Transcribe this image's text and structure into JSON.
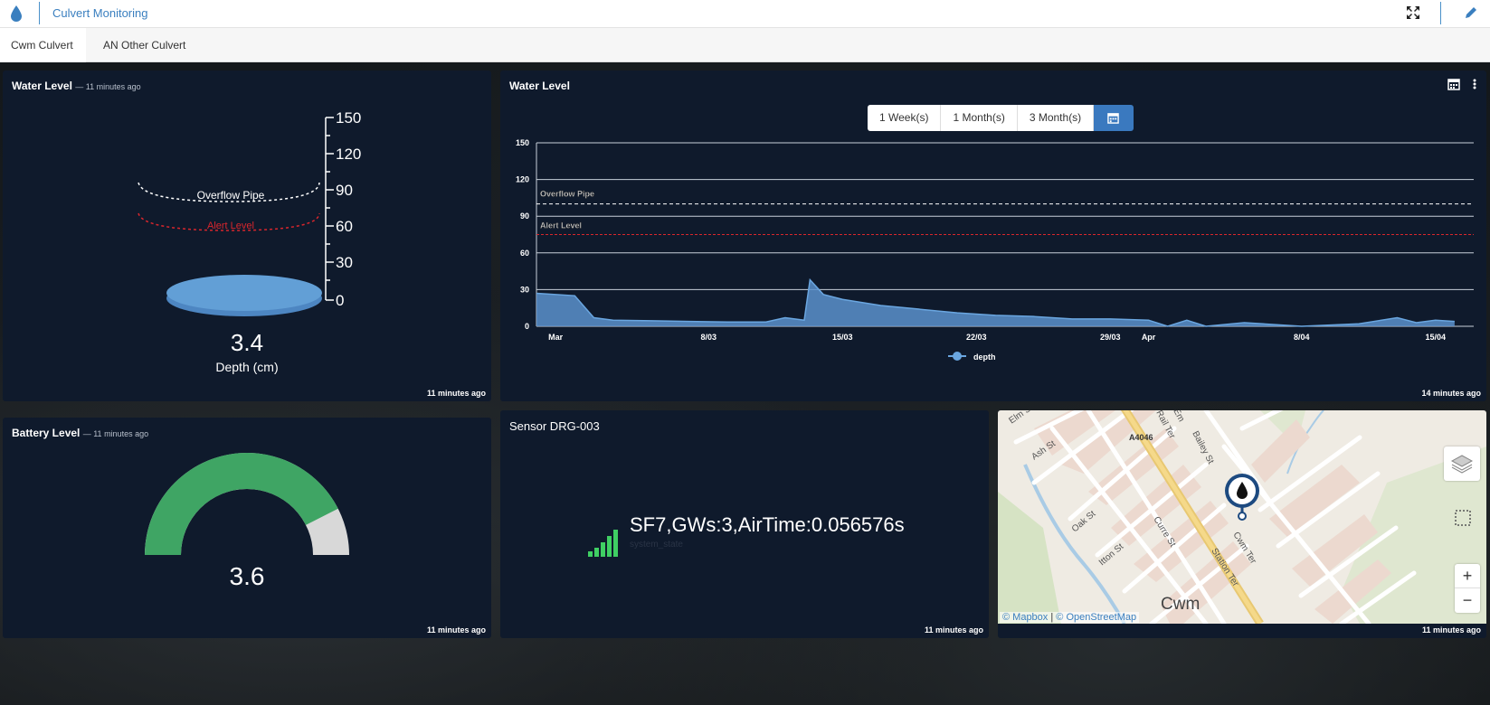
{
  "app": {
    "title": "Culvert Monitoring"
  },
  "tabs": [
    {
      "label": "Cwm Culvert",
      "active": true
    },
    {
      "label": "AN Other Culvert",
      "active": false
    }
  ],
  "water_level_widget": {
    "title": "Water Level",
    "subtitle": "— 11 minutes ago",
    "scale": [
      "150",
      "120",
      "90",
      "60",
      "30",
      "0"
    ],
    "overflow_label": "Overflow Pipe",
    "alert_label": "Alert Level",
    "value": "3.4",
    "unit_label": "Depth (cm)",
    "footer": "11 minutes ago"
  },
  "chart_widget": {
    "title": "Water Level",
    "ranges": [
      "1 Week(s)",
      "1 Month(s)",
      "3 Month(s)"
    ],
    "footer": "14 minutes ago",
    "colors": {
      "series": "#5b9bd5",
      "overflow": "#ffffff",
      "alert": "#d9262c"
    }
  },
  "chart_data": {
    "type": "area",
    "ylim": [
      0,
      150
    ],
    "yticks": [
      "0",
      "30",
      "60",
      "90",
      "120",
      "150"
    ],
    "xticks": [
      "Mar",
      "8/03",
      "15/03",
      "22/03",
      "29/03",
      "Apr",
      "8/04",
      "15/04"
    ],
    "overflow_pipe": {
      "label": "Overflow Pipe",
      "value": 100
    },
    "alert_level": {
      "label": "Alert Level",
      "value": 75
    },
    "series": [
      {
        "name": "depth",
        "x": [
          "28/02",
          "01/03",
          "02/03",
          "03/03",
          "05/03",
          "07/03",
          "09/03",
          "11/03",
          "12/03",
          "13/03",
          "13/03",
          "14/03",
          "15/03",
          "17/03",
          "19/03",
          "21/03",
          "23/03",
          "25/03",
          "27/03",
          "29/03",
          "31/03",
          "01/04",
          "02/04",
          "03/04",
          "05/04",
          "08/04",
          "11/04",
          "13/04",
          "14/04",
          "15/04",
          "16/04"
        ],
        "values": [
          27,
          25,
          7,
          5,
          4.5,
          4,
          3.5,
          3.5,
          7,
          5,
          38,
          26,
          22,
          17,
          14,
          11,
          9,
          8,
          6,
          6,
          5,
          0,
          5,
          0,
          3,
          0,
          2,
          7,
          3,
          5,
          4
        ]
      }
    ]
  },
  "battery_widget": {
    "title": "Battery Level",
    "subtitle": "— 11 minutes ago",
    "value": "3.6",
    "fraction": 0.85,
    "footer": "11 minutes ago"
  },
  "sensor_widget": {
    "title": "Sensor DRG-003",
    "status": "SF7,GWs:3,AirTime:0.056576s",
    "sub_label": "system_state",
    "footer": "11 minutes ago"
  },
  "map_widget": {
    "labels": {
      "a4046": "A4046",
      "ash": "Ash St",
      "elm": "Elm St",
      "oak": "Oak St",
      "itton": "Itton St",
      "curre": "Curre St",
      "station": "Station Ter",
      "cwmter": "Cwm Ter",
      "bailey": "Bailey St",
      "rail": "Rail Ter",
      "em": "Em",
      "town": "Cwm"
    },
    "attribution_1": "© Mapbox",
    "attribution_2": "© OpenStreetMap",
    "zoom_in": "+",
    "zoom_out": "−",
    "footer": "11 minutes ago"
  }
}
